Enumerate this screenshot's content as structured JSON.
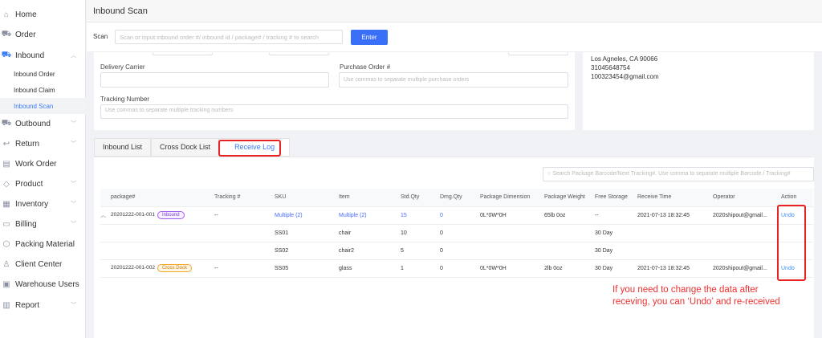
{
  "sidebar": {
    "items": [
      {
        "label": "Home",
        "icon": "home-icon"
      },
      {
        "label": "Order",
        "icon": "cart-icon"
      },
      {
        "label": "Inbound",
        "icon": "truck-icon",
        "expanded": true
      },
      {
        "label": "Inbound Order"
      },
      {
        "label": "Inbound Claim"
      },
      {
        "label": "Inbound Scan",
        "active": true
      },
      {
        "label": "Outbound",
        "icon": "truck-icon"
      },
      {
        "label": "Return",
        "icon": "return-icon"
      },
      {
        "label": "Work Order",
        "icon": "clipboard-icon"
      },
      {
        "label": "Product",
        "icon": "tag-icon"
      },
      {
        "label": "Inventory",
        "icon": "inventory-icon"
      },
      {
        "label": "Billing",
        "icon": "card-icon"
      },
      {
        "label": "Packing Material",
        "icon": "box-icon"
      },
      {
        "label": "Client Center",
        "icon": "users-icon"
      },
      {
        "label": "Warehouse Users",
        "icon": "user-card-icon"
      },
      {
        "label": "Report",
        "icon": "report-icon"
      }
    ]
  },
  "header": {
    "title": "Inbound Scan"
  },
  "scan": {
    "label": "Scan",
    "placeholder": "Scan or input inbound order #/ inbound id / package# / tracking # to search",
    "button": "Enter"
  },
  "form": {
    "delivery_carrier_label": "Delivery Carrier",
    "delivery_carrier_value": "",
    "po_label": "Purchase Order #",
    "po_placeholder": "Use commas to separate multiple purchase orders",
    "tracking_label": "Tracking Number",
    "tracking_placeholder": "Use commas to separate multiple tracking numbers"
  },
  "address": {
    "line1": "Los Agneles, CA 90066",
    "phone": "31045648754",
    "email": "100323454@gmail.com"
  },
  "tabs": [
    "Inbound List",
    "Cross Dock List",
    "Receive Log"
  ],
  "active_tab": "Receive Log",
  "log": {
    "search_placeholder": "Search Package Barcode/Next Tracking#. Use comma to separate multiple Barcode / Tracking#",
    "columns": [
      "package#",
      "Tracking #",
      "SKU",
      "Item",
      "Std.Qty",
      "Dmg.Qty",
      "Package Dimension",
      "Package Weight",
      "Free Storage",
      "Receive Time",
      "Operator",
      "Action"
    ],
    "rows": [
      {
        "package": "20201222-001-001",
        "badge": "Inbound",
        "tracking": "--",
        "sku": "Multiple (2)",
        "item": "Multiple (2)",
        "std": "15",
        "dmg": "0",
        "dim": "0L*0W*0H",
        "weight": "65lb 0oz",
        "free": "--",
        "time": "2021-07-13 18:32:45",
        "operator": "2020shipout@gmail...",
        "action": "Undo"
      },
      {
        "sku": "SS01",
        "item": "chair",
        "std": "10",
        "dmg": "0",
        "free": "30 Day"
      },
      {
        "sku": "SS02",
        "item": "chair2",
        "std": "5",
        "dmg": "0",
        "free": "30 Day"
      },
      {
        "package": "20201222-001-002",
        "badge": "Cross Dock",
        "tracking": "--",
        "sku": "SS05",
        "item": "glass",
        "std": "1",
        "dmg": "0",
        "dim": "0L*0W*0H",
        "weight": "2lb 0oz",
        "free": "30 Day",
        "time": "2021-07-13 18:32:45",
        "operator": "2020shipout@gmail...",
        "action": "Undo"
      }
    ]
  },
  "annotation": {
    "line1": "If you need to change the data after",
    "line2": "receving, you can ‘Undo’ and re-received",
    "color": "#e82222"
  }
}
